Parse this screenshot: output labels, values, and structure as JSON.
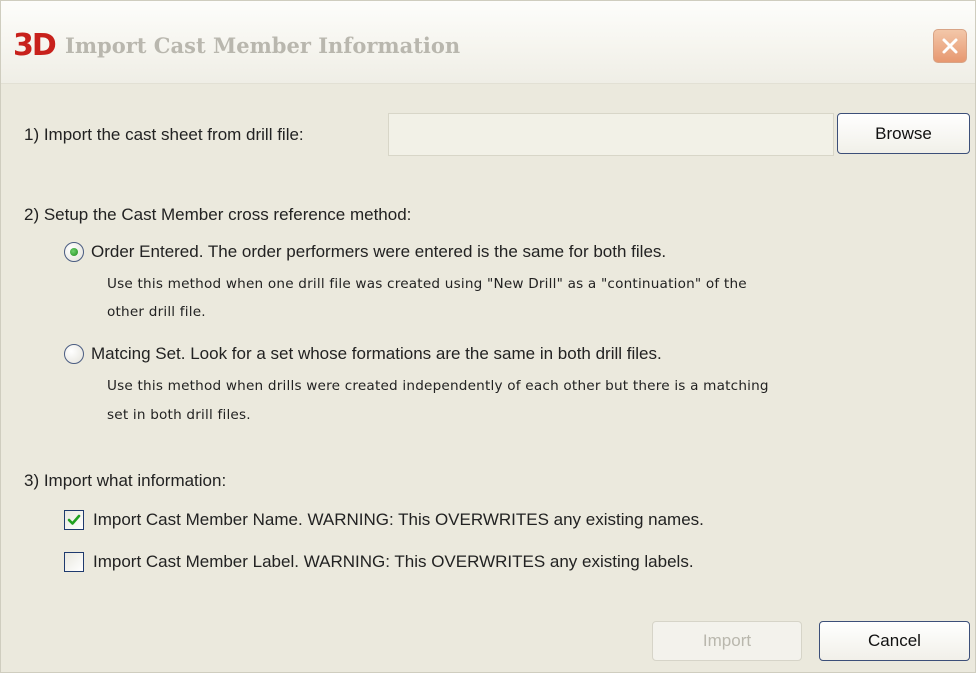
{
  "window": {
    "title": "Import Cast Member Information",
    "logo_text": "3D"
  },
  "step1": {
    "label": "1) Import the cast sheet from drill file:",
    "file_value": "",
    "browse_label": "Browse"
  },
  "step2": {
    "label": "2) Setup the Cast Member cross reference method:",
    "options": [
      {
        "label": "Order Entered.  The order performers were entered is the same for both files.",
        "description_line1": "Use this method when one drill file was created using \"New Drill\" as a \"continuation\" of the",
        "description_line2": "other drill file.",
        "selected": true
      },
      {
        "label": "Matcing Set.  Look for a set whose formations are the same in both drill files.",
        "description_line1": "Use this method when drills were created independently of each other but there is a matching",
        "description_line2": "set in both drill files.",
        "selected": false
      }
    ]
  },
  "step3": {
    "label": "3) Import what information:",
    "options": [
      {
        "label": "Import Cast Member Name.  WARNING: This OVERWRITES any existing names.",
        "checked": true
      },
      {
        "label": "Import Cast Member Label.  WARNING: This OVERWRITES any existing labels.",
        "checked": false
      }
    ]
  },
  "buttons": {
    "import_label": "Import",
    "import_enabled": false,
    "cancel_label": "Cancel"
  },
  "colors": {
    "logo": "#c8211c",
    "title_text": "#b9b7ae",
    "close_button": "#e79870",
    "dialog_background": "#ebe9dd",
    "button_border": "#3c4f79"
  },
  "icons": {
    "close": "close-icon",
    "radio_selected": "radio-selected-icon",
    "check": "check-icon"
  }
}
